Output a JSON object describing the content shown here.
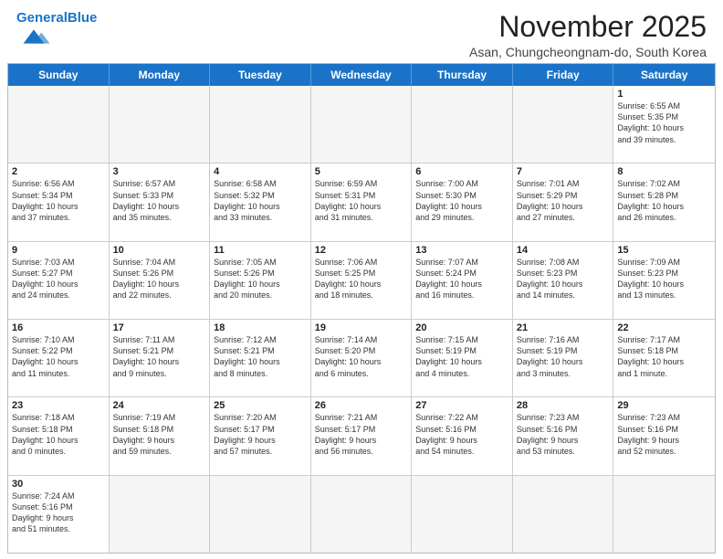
{
  "header": {
    "logo_general": "General",
    "logo_blue": "Blue",
    "title": "November 2025",
    "subtitle": "Asan, Chungcheongnam-do, South Korea"
  },
  "weekdays": [
    "Sunday",
    "Monday",
    "Tuesday",
    "Wednesday",
    "Thursday",
    "Friday",
    "Saturday"
  ],
  "rows": [
    [
      {
        "day": "",
        "info": "",
        "empty": true
      },
      {
        "day": "",
        "info": "",
        "empty": true
      },
      {
        "day": "",
        "info": "",
        "empty": true
      },
      {
        "day": "",
        "info": "",
        "empty": true
      },
      {
        "day": "",
        "info": "",
        "empty": true
      },
      {
        "day": "",
        "info": "",
        "empty": true
      },
      {
        "day": "1",
        "info": "Sunrise: 6:55 AM\nSunset: 5:35 PM\nDaylight: 10 hours\nand 39 minutes.",
        "empty": false
      }
    ],
    [
      {
        "day": "2",
        "info": "Sunrise: 6:56 AM\nSunset: 5:34 PM\nDaylight: 10 hours\nand 37 minutes.",
        "empty": false
      },
      {
        "day": "3",
        "info": "Sunrise: 6:57 AM\nSunset: 5:33 PM\nDaylight: 10 hours\nand 35 minutes.",
        "empty": false
      },
      {
        "day": "4",
        "info": "Sunrise: 6:58 AM\nSunset: 5:32 PM\nDaylight: 10 hours\nand 33 minutes.",
        "empty": false
      },
      {
        "day": "5",
        "info": "Sunrise: 6:59 AM\nSunset: 5:31 PM\nDaylight: 10 hours\nand 31 minutes.",
        "empty": false
      },
      {
        "day": "6",
        "info": "Sunrise: 7:00 AM\nSunset: 5:30 PM\nDaylight: 10 hours\nand 29 minutes.",
        "empty": false
      },
      {
        "day": "7",
        "info": "Sunrise: 7:01 AM\nSunset: 5:29 PM\nDaylight: 10 hours\nand 27 minutes.",
        "empty": false
      },
      {
        "day": "8",
        "info": "Sunrise: 7:02 AM\nSunset: 5:28 PM\nDaylight: 10 hours\nand 26 minutes.",
        "empty": false
      }
    ],
    [
      {
        "day": "9",
        "info": "Sunrise: 7:03 AM\nSunset: 5:27 PM\nDaylight: 10 hours\nand 24 minutes.",
        "empty": false
      },
      {
        "day": "10",
        "info": "Sunrise: 7:04 AM\nSunset: 5:26 PM\nDaylight: 10 hours\nand 22 minutes.",
        "empty": false
      },
      {
        "day": "11",
        "info": "Sunrise: 7:05 AM\nSunset: 5:26 PM\nDaylight: 10 hours\nand 20 minutes.",
        "empty": false
      },
      {
        "day": "12",
        "info": "Sunrise: 7:06 AM\nSunset: 5:25 PM\nDaylight: 10 hours\nand 18 minutes.",
        "empty": false
      },
      {
        "day": "13",
        "info": "Sunrise: 7:07 AM\nSunset: 5:24 PM\nDaylight: 10 hours\nand 16 minutes.",
        "empty": false
      },
      {
        "day": "14",
        "info": "Sunrise: 7:08 AM\nSunset: 5:23 PM\nDaylight: 10 hours\nand 14 minutes.",
        "empty": false
      },
      {
        "day": "15",
        "info": "Sunrise: 7:09 AM\nSunset: 5:23 PM\nDaylight: 10 hours\nand 13 minutes.",
        "empty": false
      }
    ],
    [
      {
        "day": "16",
        "info": "Sunrise: 7:10 AM\nSunset: 5:22 PM\nDaylight: 10 hours\nand 11 minutes.",
        "empty": false
      },
      {
        "day": "17",
        "info": "Sunrise: 7:11 AM\nSunset: 5:21 PM\nDaylight: 10 hours\nand 9 minutes.",
        "empty": false
      },
      {
        "day": "18",
        "info": "Sunrise: 7:12 AM\nSunset: 5:21 PM\nDaylight: 10 hours\nand 8 minutes.",
        "empty": false
      },
      {
        "day": "19",
        "info": "Sunrise: 7:14 AM\nSunset: 5:20 PM\nDaylight: 10 hours\nand 6 minutes.",
        "empty": false
      },
      {
        "day": "20",
        "info": "Sunrise: 7:15 AM\nSunset: 5:19 PM\nDaylight: 10 hours\nand 4 minutes.",
        "empty": false
      },
      {
        "day": "21",
        "info": "Sunrise: 7:16 AM\nSunset: 5:19 PM\nDaylight: 10 hours\nand 3 minutes.",
        "empty": false
      },
      {
        "day": "22",
        "info": "Sunrise: 7:17 AM\nSunset: 5:18 PM\nDaylight: 10 hours\nand 1 minute.",
        "empty": false
      }
    ],
    [
      {
        "day": "23",
        "info": "Sunrise: 7:18 AM\nSunset: 5:18 PM\nDaylight: 10 hours\nand 0 minutes.",
        "empty": false
      },
      {
        "day": "24",
        "info": "Sunrise: 7:19 AM\nSunset: 5:18 PM\nDaylight: 9 hours\nand 59 minutes.",
        "empty": false
      },
      {
        "day": "25",
        "info": "Sunrise: 7:20 AM\nSunset: 5:17 PM\nDaylight: 9 hours\nand 57 minutes.",
        "empty": false
      },
      {
        "day": "26",
        "info": "Sunrise: 7:21 AM\nSunset: 5:17 PM\nDaylight: 9 hours\nand 56 minutes.",
        "empty": false
      },
      {
        "day": "27",
        "info": "Sunrise: 7:22 AM\nSunset: 5:16 PM\nDaylight: 9 hours\nand 54 minutes.",
        "empty": false
      },
      {
        "day": "28",
        "info": "Sunrise: 7:23 AM\nSunset: 5:16 PM\nDaylight: 9 hours\nand 53 minutes.",
        "empty": false
      },
      {
        "day": "29",
        "info": "Sunrise: 7:23 AM\nSunset: 5:16 PM\nDaylight: 9 hours\nand 52 minutes.",
        "empty": false
      }
    ],
    [
      {
        "day": "30",
        "info": "Sunrise: 7:24 AM\nSunset: 5:16 PM\nDaylight: 9 hours\nand 51 minutes.",
        "empty": false
      },
      {
        "day": "",
        "info": "",
        "empty": true
      },
      {
        "day": "",
        "info": "",
        "empty": true
      },
      {
        "day": "",
        "info": "",
        "empty": true
      },
      {
        "day": "",
        "info": "",
        "empty": true
      },
      {
        "day": "",
        "info": "",
        "empty": true
      },
      {
        "day": "",
        "info": "",
        "empty": true
      }
    ]
  ]
}
